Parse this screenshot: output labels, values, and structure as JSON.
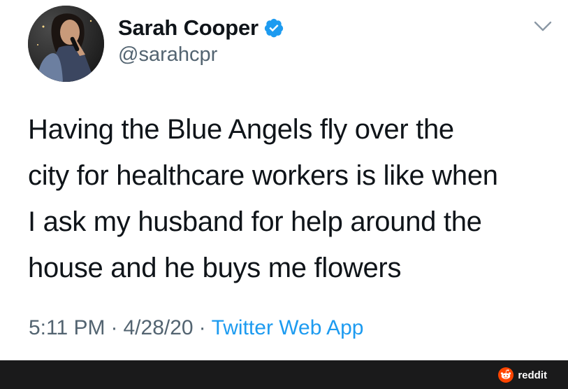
{
  "tweet": {
    "display_name": "Sarah Cooper",
    "handle": "@sarahcpr",
    "verified_icon": "verified-badge-icon",
    "menu_icon": "chevron-down-icon",
    "text_lines": [
      "Having the Blue Angels fly over the",
      "city for healthcare workers is like when",
      "I ask my husband for help around the",
      "house and he buys me flowers"
    ],
    "time": "5:11 PM",
    "separator": "·",
    "date": "4/28/20",
    "source": "Twitter Web App"
  },
  "watermark": {
    "label": "reddit",
    "icon": "reddit-logo-icon"
  },
  "colors": {
    "verified_blue": "#1d9bf0",
    "link_blue": "#1d9bf0",
    "secondary_text": "#536471",
    "footer_bg": "#1a1a1b",
    "reddit_orange": "#ff4500"
  }
}
